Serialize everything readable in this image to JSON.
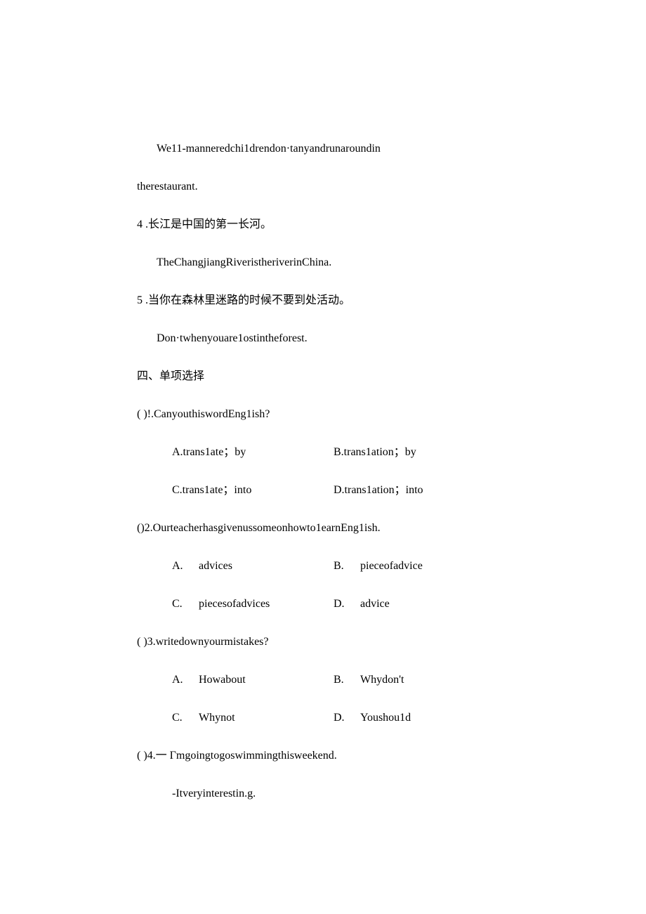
{
  "p1": "We11-manneredchi1drendon·tanyandrunaroundin",
  "p2": "therestaurant.",
  "q4_num": "4",
  "q4_cn": " .长江是中国的第一长河。",
  "q4_en": "TheChangjiangRiveristheriverinChina.",
  "q5_num": "5",
  "q5_cn": " .当你在森林里迷路的时候不要到处活动。",
  "q5_en": "Don·twhenyouare1ostintheforest.",
  "section4": "四、单项选择",
  "mc1_stem": "(      )!.CanyouthiswordEng1ish?",
  "mc1_a": "A.trans1ate；by",
  "mc1_b": "B.trans1ation；by",
  "mc1_c": "C.trans1ate；into",
  "mc1_d": "D.trans1ation；into",
  "mc2_stem": "()2.Ourteacherhasgivenussomeonhowto1earnEng1ish.",
  "mc2_a_l": "A.",
  "mc2_a_t": "advices",
  "mc2_b_l": "B.",
  "mc2_b_t": "pieceofadvice",
  "mc2_c_l": "C.",
  "mc2_c_t": "piecesofadvices",
  "mc2_d_l": "D.",
  "mc2_d_t": "advice",
  "mc3_stem": "(      )3.writedownyourmistakes?",
  "mc3_a_l": "A.",
  "mc3_a_t": "Howabout",
  "mc3_b_l": "B.",
  "mc3_b_t": "Whydon't",
  "mc3_c_l": "C.",
  "mc3_c_t": "Whynot",
  "mc3_d_l": "D.",
  "mc3_d_t": "Youshou1d",
  "mc4_stem": "(      )4.一 Γmgoingtogoswimmingthisweekend.",
  "mc4_ans": "-Itveryinterestin.g."
}
